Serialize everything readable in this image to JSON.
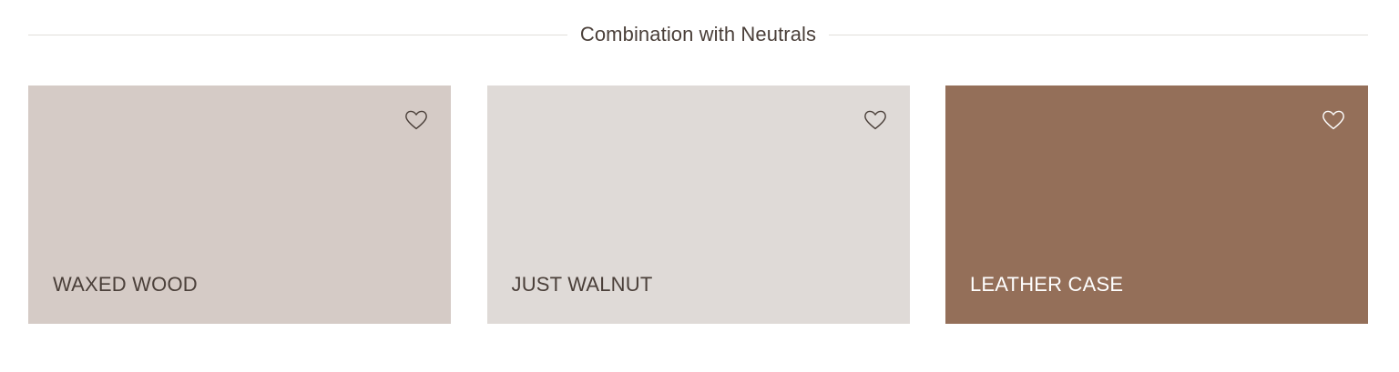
{
  "section": {
    "title": "Combination with Neutrals"
  },
  "cards": [
    {
      "name": "WAXED WOOD",
      "swatch_color": "#d5cbc6",
      "text_color": "#4a3f39",
      "icon": "heart-outline-icon"
    },
    {
      "name": "JUST WALNUT",
      "swatch_color": "#dfdad7",
      "text_color": "#4a3f39",
      "icon": "heart-outline-icon"
    },
    {
      "name": "LEATHER CASE",
      "swatch_color": "#946f59",
      "text_color": "#ffffff",
      "icon": "heart-outline-icon"
    }
  ]
}
